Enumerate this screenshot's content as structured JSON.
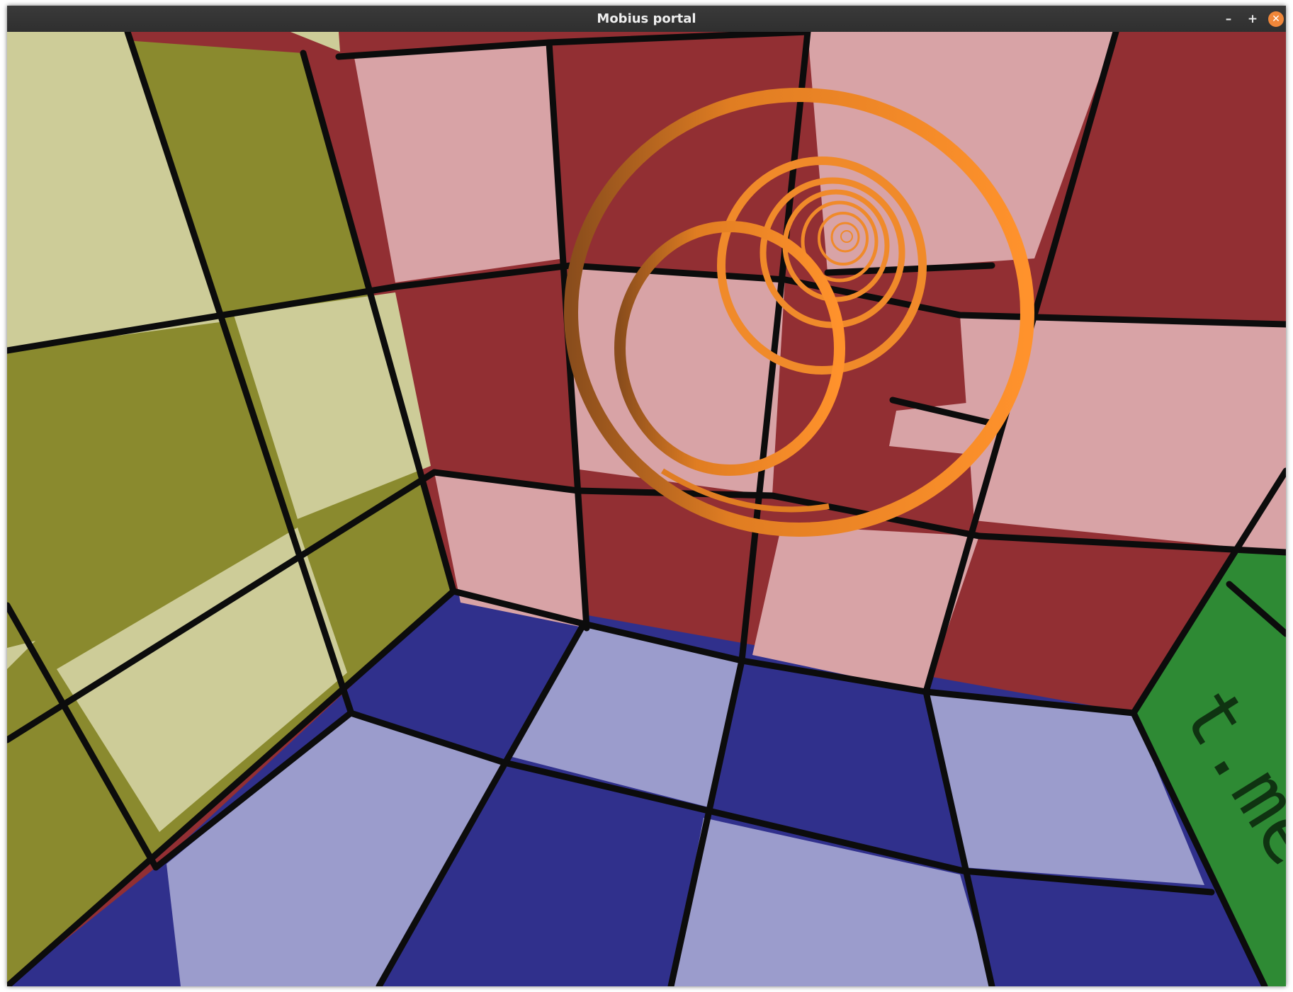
{
  "window": {
    "title": "Mobius portal",
    "controls": {
      "minimize": "–",
      "maximize": "+",
      "close": "✕"
    }
  },
  "scene": {
    "portal_color": "#f08a2a",
    "wall_colors": {
      "left_light": "#cdcc98",
      "left_dark": "#8a8a2e",
      "back_light": "#d8a3a6",
      "back_dark": "#922f33",
      "floor_light": "#9b9ccc",
      "floor_dark": "#30308c",
      "right": "#2e8a34"
    },
    "right_wall_text": "t.me"
  }
}
